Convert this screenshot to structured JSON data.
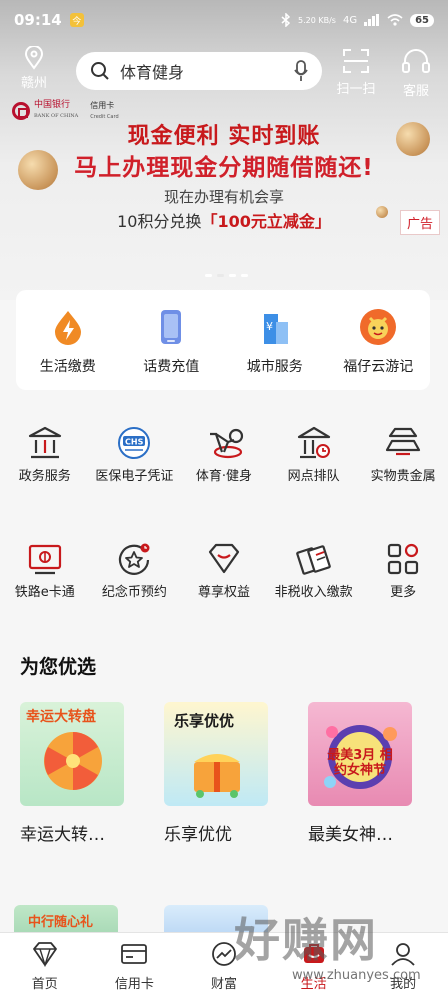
{
  "status_bar": {
    "time": "09:14",
    "notif_glyph": "今",
    "net_speed": "5.20 KB/s",
    "net_type": "4G",
    "battery": "65"
  },
  "header": {
    "location": "赣州",
    "search_placeholder": "体育健身",
    "scan_label": "扫一扫",
    "service_label": "客服"
  },
  "banner": {
    "brand": "中国银行",
    "brand_en": "BANK OF CHINA",
    "card": "信用卡",
    "card_en": "Credit Card",
    "line1": "现金便利  实时到账",
    "line2": "马上办理现金分期随借随还!",
    "line3": "现在办理有机会享",
    "line4_a": "10积分兑换",
    "line4_b": "「100元立减金」",
    "ad_tag": "广告"
  },
  "quick_services": [
    {
      "label": "生活缴费",
      "icon": "drop-bolt-icon"
    },
    {
      "label": "话费充值",
      "icon": "phone-icon"
    },
    {
      "label": "城市服务",
      "icon": "city-icon"
    },
    {
      "label": "福仔云游记",
      "icon": "mascot-icon"
    }
  ],
  "services_row1": [
    {
      "label": "政务服务",
      "icon": "government-icon"
    },
    {
      "label": "医保电子凭证",
      "icon": "chs-icon"
    },
    {
      "label": "体育·健身",
      "icon": "bike-icon"
    },
    {
      "label": "网点排队",
      "icon": "branch-queue-icon"
    },
    {
      "label": "实物贵金属",
      "icon": "gold-ingot-icon"
    }
  ],
  "services_row2": [
    {
      "label": "铁路e卡通",
      "icon": "rail-card-icon"
    },
    {
      "label": "纪念币预约",
      "icon": "coin-star-icon"
    },
    {
      "label": "尊享权益",
      "icon": "diamond-icon"
    },
    {
      "label": "非税收入缴款",
      "icon": "tickets-icon"
    },
    {
      "label": "更多",
      "icon": "grid-icon"
    }
  ],
  "recommend": {
    "title": "为您优选",
    "items": [
      {
        "name": "幸运大转…",
        "img_text": "幸运大转盘"
      },
      {
        "name": "乐享优优",
        "img_text": "乐享优优"
      },
      {
        "name": "最美女神…",
        "img_text": "最美3月 相约女神节"
      }
    ],
    "row2_text": "中行随心礼"
  },
  "tabs": [
    {
      "label": "首页",
      "icon": "diamond-outline-icon"
    },
    {
      "label": "信用卡",
      "icon": "card-icon"
    },
    {
      "label": "财富",
      "icon": "chart-icon"
    },
    {
      "label": "生活",
      "icon": "life-icon",
      "active": true
    },
    {
      "label": "我的",
      "icon": "user-icon"
    }
  ],
  "watermark": {
    "big": "好赚网",
    "small": "www.zhuanyes.com"
  },
  "colors": {
    "brand_red": "#c8191c",
    "orange": "#f08a24",
    "blue": "#3d8fe6"
  }
}
